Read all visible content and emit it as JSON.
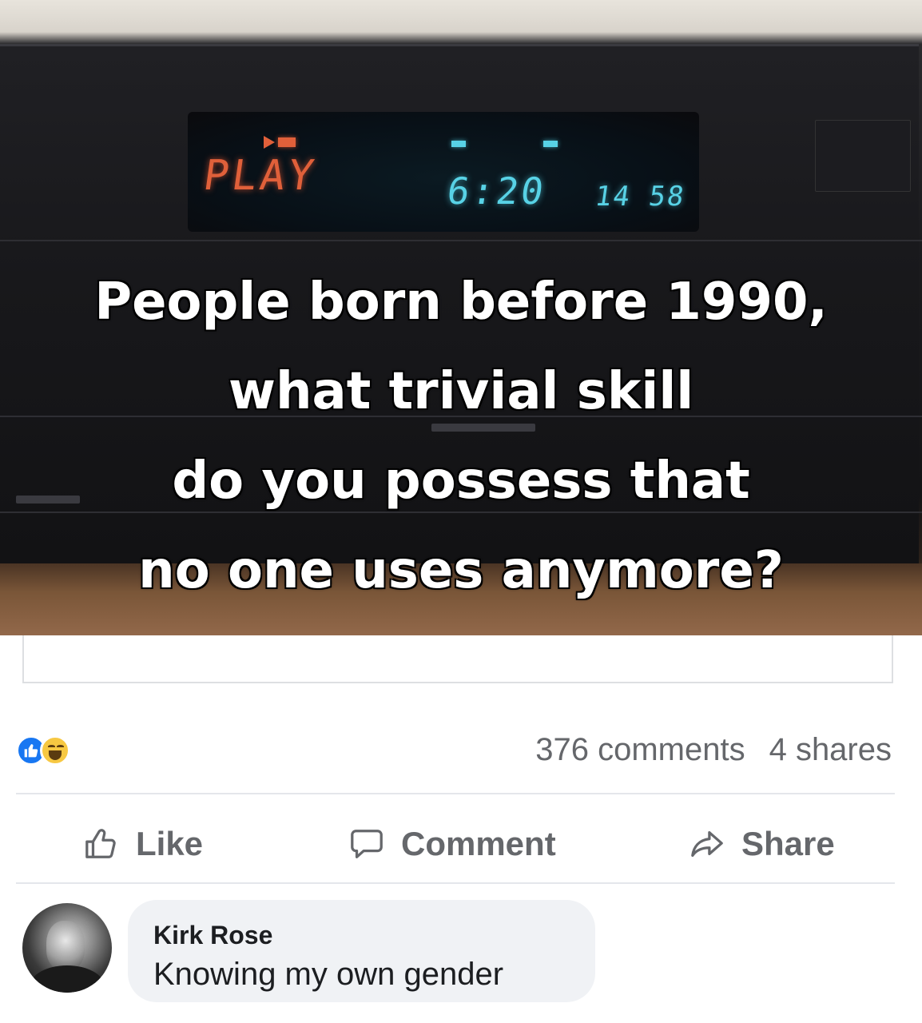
{
  "post": {
    "image": {
      "vcr_display": {
        "mode": "PLAY",
        "time": "6:20",
        "seconds": "14 58"
      },
      "caption_lines": [
        "People born before 1990,",
        "what trivial skill",
        "do you possess that",
        "no one uses anymore?"
      ]
    },
    "reactions": [
      "like",
      "haha"
    ],
    "comments_count": "376 comments",
    "shares_count": "4 shares"
  },
  "actions": {
    "like_label": "Like",
    "comment_label": "Comment",
    "share_label": "Share"
  },
  "comment": {
    "author": "Kirk Rose",
    "text": "Knowing my own gender"
  },
  "colors": {
    "accent": "#1877f2",
    "muted_text": "#65676b",
    "bubble_bg": "#f0f2f5",
    "lcd_orange": "#e0603a",
    "lcd_cyan": "#58d2e6"
  }
}
